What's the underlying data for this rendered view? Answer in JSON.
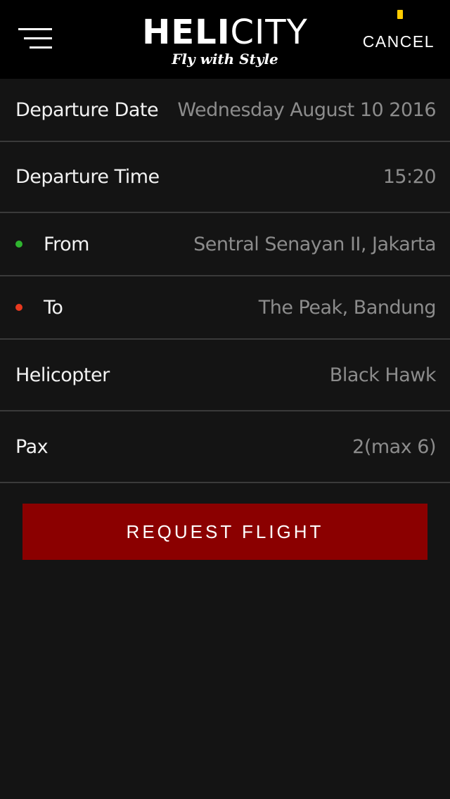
{
  "header": {
    "logo_bold": "HELI",
    "logo_light": "CITY",
    "tagline": "Fly with Style",
    "cancel_label": "CANCEL",
    "indicator_color": "#ffcc00"
  },
  "form": {
    "rows": [
      {
        "label": "Departure Date",
        "value": "Wednesday August 10 2016"
      },
      {
        "label": "Departure Time",
        "value": "15:20"
      },
      {
        "label": "From",
        "value": "Sentral Senayan II, Jakarta",
        "dot_color": "#2fb52f"
      },
      {
        "label": "To",
        "value": "The Peak, Bandung",
        "dot_color": "#e8391f"
      },
      {
        "label": "Helicopter",
        "value": "Black Hawk"
      },
      {
        "label": "Pax",
        "value": "2(max 6)"
      }
    ]
  },
  "action": {
    "request_label": "REQUEST FLIGHT",
    "request_color": "#8b0000"
  },
  "icons": {
    "menu": "hamburger-menu-icon",
    "from": "green-dot-icon",
    "to": "red-dot-icon"
  }
}
